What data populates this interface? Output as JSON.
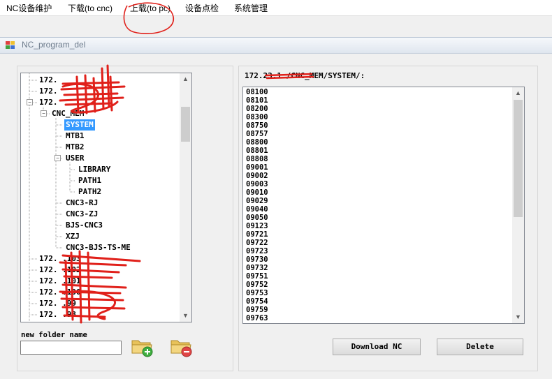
{
  "menu": [
    {
      "label": "NC设备维护"
    },
    {
      "label": "下载(to cnc)"
    },
    {
      "label": "上载(to pc)"
    },
    {
      "label": "设备点检"
    },
    {
      "label": "系统管理"
    }
  ],
  "window": {
    "title": "NC_program_del"
  },
  "tree": {
    "nodes": [
      {
        "label": "172."
      },
      {
        "label": "172."
      },
      {
        "label": "172."
      },
      {
        "label": "CNC_MEM"
      },
      {
        "label": "SYSTEM",
        "selected": true
      },
      {
        "label": "MTB1"
      },
      {
        "label": "MTB2"
      },
      {
        "label": "USER"
      },
      {
        "label": "LIBRARY"
      },
      {
        "label": "PATH1"
      },
      {
        "label": "PATH2"
      },
      {
        "label": "CNC3-RJ"
      },
      {
        "label": "CNC3-ZJ"
      },
      {
        "label": "BJS-CNC3"
      },
      {
        "label": "XZJ"
      },
      {
        "label": "CNC3-BJS-TS-ME"
      },
      {
        "label": "172.  .103"
      },
      {
        "label": "172.  .102"
      },
      {
        "label": "172.  .101"
      },
      {
        "label": "172.  .100"
      },
      {
        "label": "172.  .99"
      },
      {
        "label": "172.  .98"
      }
    ]
  },
  "program_list": {
    "path_label": "172.23.1   /CNC_MEM/SYSTEM/:",
    "items": [
      "08100",
      "08101",
      "08200",
      "08300",
      "08750",
      "08757",
      "08800",
      "08801",
      "08808",
      "09001",
      "09002",
      "09003",
      "09010",
      "09029",
      "09040",
      "09050",
      "09123",
      "09721",
      "09722",
      "09723",
      "09730",
      "09732",
      "09751",
      "09752",
      "09753",
      "09754",
      "09759",
      "09763"
    ]
  },
  "new_folder": {
    "label": "new folder name",
    "value": ""
  },
  "buttons": {
    "download": "Download NC",
    "delete": "Delete"
  },
  "icons": {
    "add_folder": "folder-add-icon",
    "remove_folder": "folder-remove-icon"
  }
}
